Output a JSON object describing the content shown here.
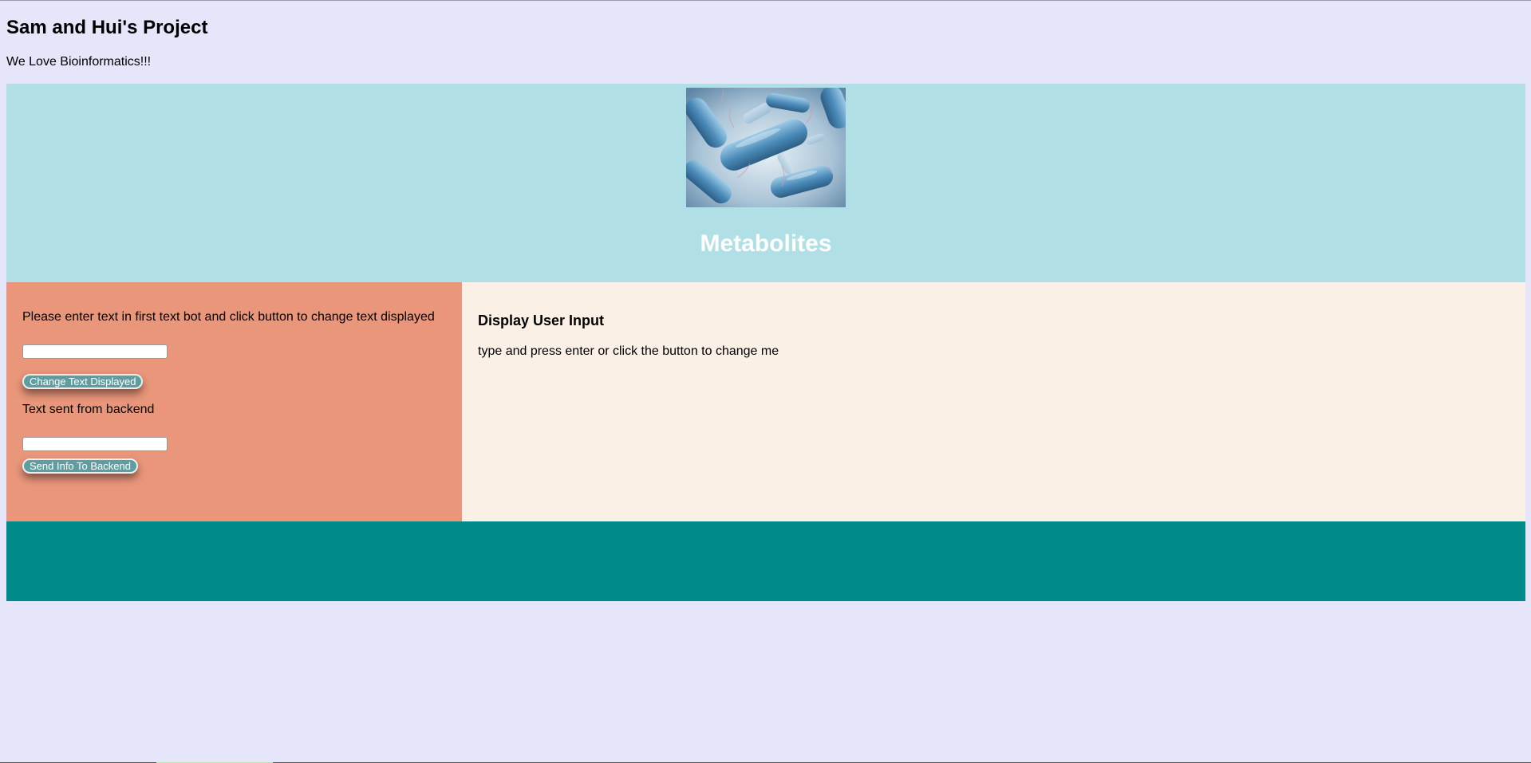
{
  "header": {
    "title": "Sam and Hui's Project",
    "tagline": "We Love Bioinformatics!!!"
  },
  "hero": {
    "image_icon": "bacteria-illustration",
    "title": "Metabolites"
  },
  "form": {
    "instructions": "Please enter text in first text bot and click button to change text displayed",
    "text_input_value": "",
    "change_button_label": "Change Text Displayed",
    "backend_label": "Text sent from backend",
    "backend_input_value": "",
    "send_button_label": "Send Info To Backend"
  },
  "display": {
    "heading": "Display User Input",
    "text": "type and press enter or click the button to change me"
  },
  "colors": {
    "page_bg": "#e6e6fa",
    "header_panel": "#b0e0e6",
    "left_panel": "#e9967a",
    "right_panel": "#faf0e6",
    "footer_panel": "#008b8b",
    "button": "#5f9ea0"
  }
}
